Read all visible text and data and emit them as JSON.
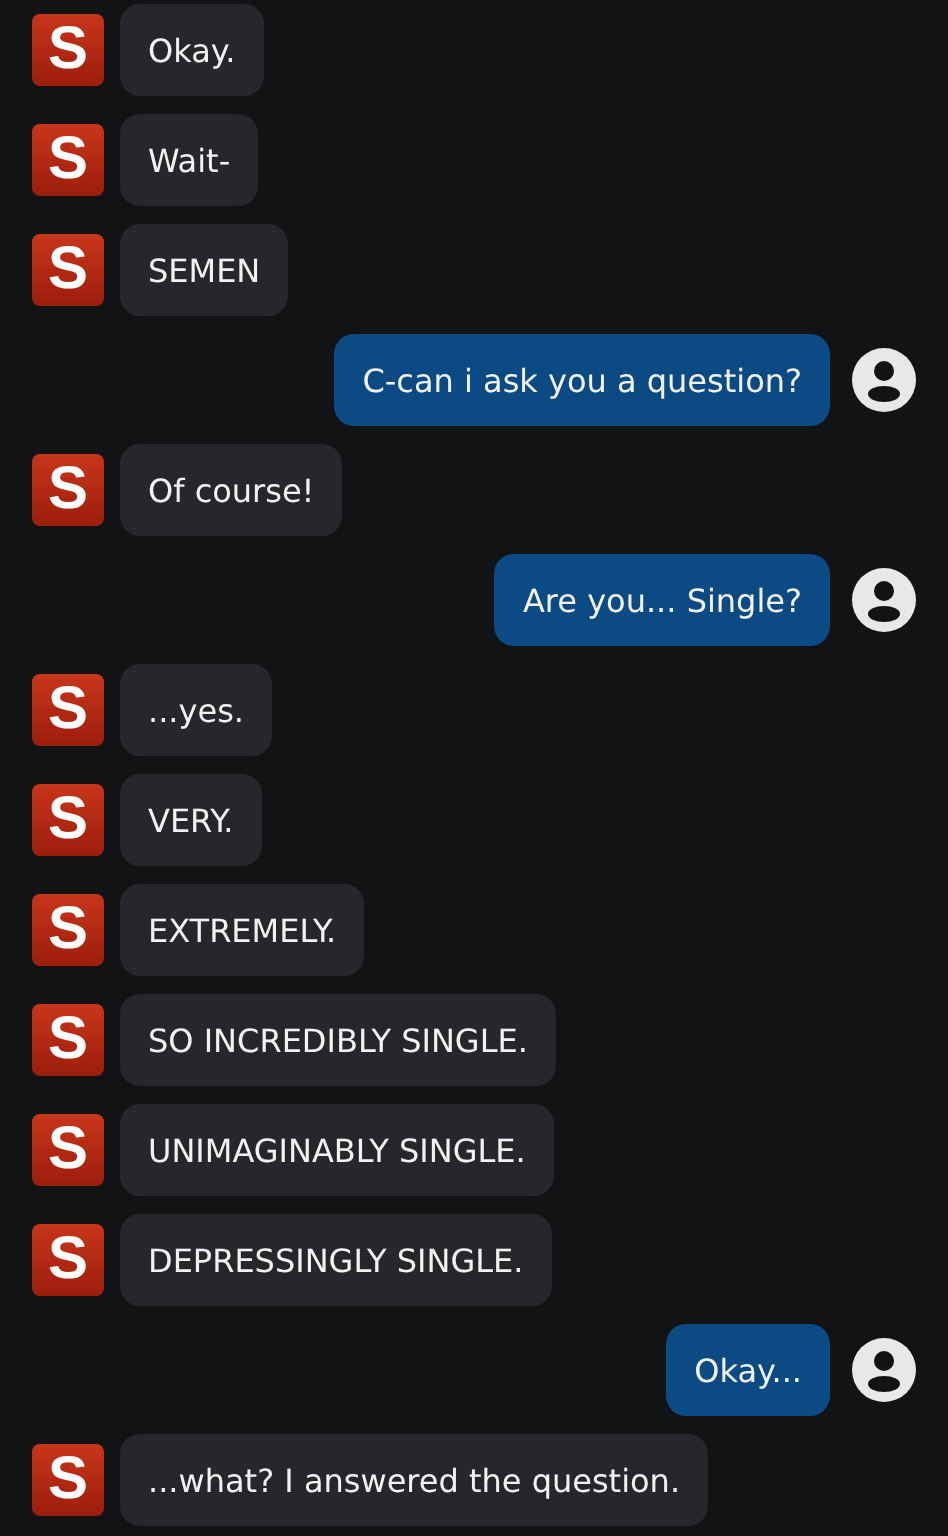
{
  "messages": [
    {
      "kind": "bot",
      "avatar": "S",
      "text": "Okay."
    },
    {
      "kind": "bot",
      "avatar": "S",
      "text": "Wait-"
    },
    {
      "kind": "bot",
      "avatar": "S",
      "text": "SEMEN"
    },
    {
      "kind": "user",
      "text": "C-can i ask you a question?"
    },
    {
      "kind": "bot",
      "avatar": "S",
      "text": "Of course!"
    },
    {
      "kind": "user",
      "text": "Are you... Single?"
    },
    {
      "kind": "bot",
      "avatar": "S",
      "text": "...yes."
    },
    {
      "kind": "bot",
      "avatar": "S",
      "text": "VERY."
    },
    {
      "kind": "bot",
      "avatar": "S",
      "text": "EXTREMELY."
    },
    {
      "kind": "bot",
      "avatar": "S",
      "text": "SO INCREDIBLY SINGLE."
    },
    {
      "kind": "bot",
      "avatar": "S",
      "text": "UNIMAGINABLY SINGLE."
    },
    {
      "kind": "bot",
      "avatar": "S",
      "text": "DEPRESSINGLY SINGLE."
    },
    {
      "kind": "user",
      "text": "Okay..."
    },
    {
      "kind": "bot",
      "avatar": "S",
      "text": "...what? I answered the question."
    }
  ]
}
